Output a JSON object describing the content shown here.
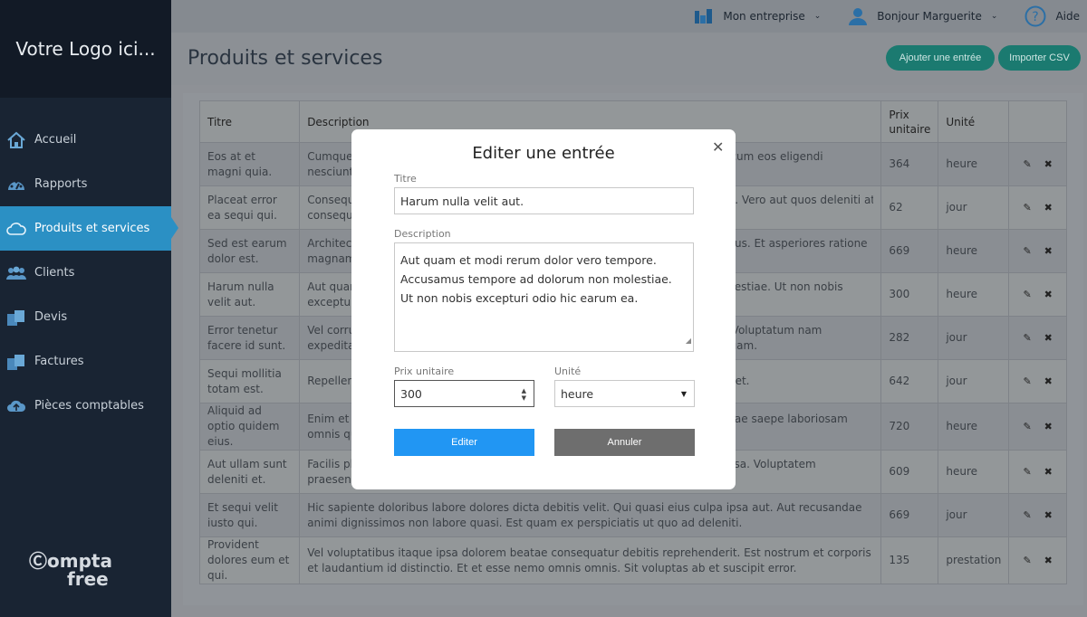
{
  "sidebar": {
    "logo_text": "Votre Logo ici...",
    "items": [
      {
        "label": "Accueil",
        "icon": "home-icon"
      },
      {
        "label": "Rapports",
        "icon": "dashboard-icon"
      },
      {
        "label": "Produits et services",
        "icon": "cloud-icon"
      },
      {
        "label": "Clients",
        "icon": "users-icon"
      },
      {
        "label": "Devis",
        "icon": "documents-icon"
      },
      {
        "label": "Factures",
        "icon": "documents-icon"
      },
      {
        "label": "Pièces comptables",
        "icon": "cloud-upload-icon"
      }
    ],
    "brand_line1": "ompta",
    "brand_line2": "free"
  },
  "topbar": {
    "company": "Mon entreprise",
    "greeting": "Bonjour Marguerite",
    "help": "Aide"
  },
  "header": {
    "title": "Produits et services",
    "add_button": "Ajouter une entrée",
    "import_button": "Importer CSV"
  },
  "table": {
    "headers": [
      "Titre",
      "Description",
      "Prix unitaire",
      "Unité",
      ""
    ],
    "rows": [
      {
        "title": "Eos at et magni quia.",
        "desc_left": "Cumque",
        "desc_left2": "nesciunt.",
        "desc_right": "ex cum eos eligendi",
        "desc_right2": "",
        "price": "364",
        "unit": "heure"
      },
      {
        "title": "Placeat error ea sequi qui.",
        "desc_left": "Consequ",
        "desc_left2": "consequa",
        "desc_right": "cilis. Vero aut quos deleniti at",
        "desc_right2": "",
        "price": "62",
        "unit": "jour"
      },
      {
        "title": "Sed est earum dolor est.",
        "desc_left": "Architect",
        "desc_left2": "magnam",
        "desc_right": "minus. Et asperiores ratione",
        "desc_right2": "",
        "price": "669",
        "unit": "heure"
      },
      {
        "title": "Harum nulla velit aut.",
        "desc_left": "Aut quam",
        "desc_left2": "excepturi",
        "desc_right": "molestiae. Ut non nobis",
        "desc_right2": "",
        "price": "300",
        "unit": "heure"
      },
      {
        "title": "Error tenetur facere id sunt.",
        "desc_left": "Vel corru",
        "desc_left2": "expedita",
        "desc_right": "m. Voluptatum nam",
        "desc_right2": "isquam.",
        "price": "282",
        "unit": "jour"
      },
      {
        "title": "Sequi mollitia totam est.",
        "desc_left": "Repellen",
        "desc_left2": "",
        "desc_right": "ore et.",
        "desc_right2": "",
        "price": "642",
        "unit": "jour"
      },
      {
        "title": "Aliquid ad optio quidem eius.",
        "desc_left": "Enim et v",
        "desc_left2": "omnis qu",
        "desc_right": "andae saepe laboriosam",
        "desc_right2": "",
        "price": "720",
        "unit": "heure"
      },
      {
        "title": "Aut ullam sunt deleniti et.",
        "desc_left": "Facilis pl",
        "desc_left2": "praesent",
        "desc_right": "o ipsa. Voluptatem",
        "desc_right2": "",
        "price": "609",
        "unit": "heure"
      },
      {
        "title": "Et sequi velit iusto qui.",
        "desc_full": "Hic sapiente doloribus labore dolores dicta debitis velit. Qui quasi eius culpa ipsa aut. Aut recusandae animi dignissimos non labore quasi. Est quam ex perspiciatis ut quo ad deleniti.",
        "price": "669",
        "unit": "jour"
      },
      {
        "title": "Provident dolores eum et qui.",
        "desc_full": "Vel voluptatibus itaque ipsa dolorem beatae consequatur debitis reprehenderit. Est nostrum et corporis et laudantium id distinctio. Et et esse nemo omnis omnis. Sit voluptas ab et suscipit error.",
        "price": "135",
        "unit": "prestation"
      }
    ]
  },
  "modal": {
    "title": "Editer une entrée",
    "title_label": "Titre",
    "title_value": "Harum nulla velit aut.",
    "description_label": "Description",
    "description_value": "Aut quam et modi rerum dolor vero tempore. Accusamus tempore ad dolorum non molestiae. Ut non nobis excepturi odio hic earum ea.",
    "price_label": "Prix unitaire",
    "price_value": "300",
    "unit_label": "Unité",
    "unit_value": "heure",
    "submit_label": "Editer",
    "cancel_label": "Annuler",
    "submit_color": "#2196f3",
    "cancel_color": "#6e6e6e"
  }
}
